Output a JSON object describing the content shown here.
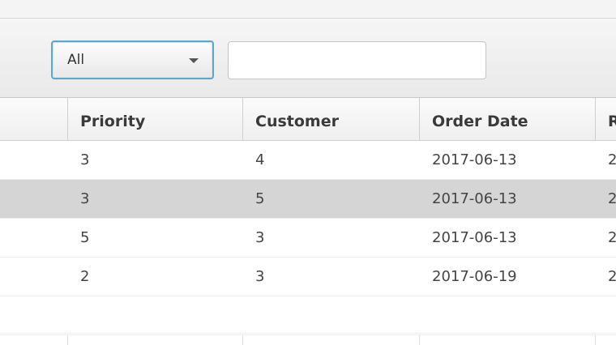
{
  "toolbar": {
    "filter": {
      "selected": "All"
    },
    "search": {
      "value": "",
      "placeholder": ""
    }
  },
  "table": {
    "columns": [
      "Priority",
      "Customer",
      "Order Date",
      "R"
    ],
    "rows": [
      [
        "3",
        "4",
        "2017-06-13",
        "2"
      ],
      [
        "3",
        "5",
        "2017-06-13",
        "2"
      ],
      [
        "5",
        "3",
        "2017-06-13",
        "2"
      ],
      [
        "2",
        "3",
        "2017-06-19",
        "2"
      ]
    ],
    "selected_row": 1
  }
}
